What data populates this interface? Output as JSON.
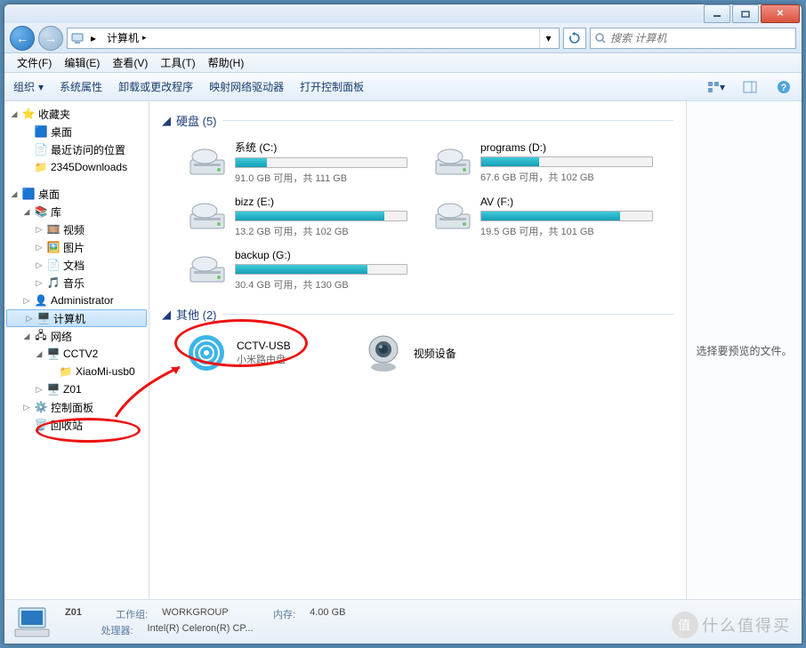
{
  "addr": {
    "segment": "计算机",
    "arrow": "▸"
  },
  "search": {
    "placeholder": "搜索 计算机"
  },
  "menu": {
    "file": "文件(F)",
    "edit": "编辑(E)",
    "view": "查看(V)",
    "tools": "工具(T)",
    "help": "帮助(H)"
  },
  "toolbar": {
    "organize": "组织",
    "sysprops": "系统属性",
    "uninstall": "卸载或更改程序",
    "mapdrive": "映射网络驱动器",
    "controlpanel": "打开控制面板"
  },
  "tree": {
    "favorites": "收藏夹",
    "desktop_fav": "桌面",
    "recent": "最近访问的位置",
    "downloads": "2345Downloads",
    "desktop": "桌面",
    "libraries": "库",
    "videos": "视频",
    "pictures": "图片",
    "documents": "文档",
    "music": "音乐",
    "admin": "Administrator",
    "computer": "计算机",
    "network": "网络",
    "cctv2": "CCTV2",
    "xiaomi": "XiaoMi-usb0",
    "z01": "Z01",
    "control": "控制面板",
    "recycle": "回收站"
  },
  "groups": {
    "hdd": "硬盘 (5)",
    "other": "其他 (2)"
  },
  "drives": [
    {
      "name": "系统 (C:)",
      "sub": "91.0 GB 可用，共 111 GB",
      "fill": 18
    },
    {
      "name": "programs (D:)",
      "sub": "67.6 GB 可用，共 102 GB",
      "fill": 34
    },
    {
      "name": "bizz (E:)",
      "sub": "13.2 GB 可用，共 102 GB",
      "fill": 87
    },
    {
      "name": "AV (F:)",
      "sub": "19.5 GB 可用，共 101 GB",
      "fill": 81
    },
    {
      "name": "backup (G:)",
      "sub": "30.4 GB 可用，共 130 GB",
      "fill": 77
    }
  ],
  "others": {
    "cctv_name": "CCTV-USB",
    "cctv_sub": "小米路由盘",
    "webcam": "视频设备"
  },
  "preview": {
    "text": "选择要预览的文件。"
  },
  "status": {
    "name": "Z01",
    "workgroup_label": "工作组:",
    "workgroup": "WORKGROUP",
    "memory_label": "内存:",
    "memory": "4.00 GB",
    "cpu_label": "处理器:",
    "cpu": "Intel(R) Celeron(R) CP..."
  },
  "watermark": "什么值得买"
}
